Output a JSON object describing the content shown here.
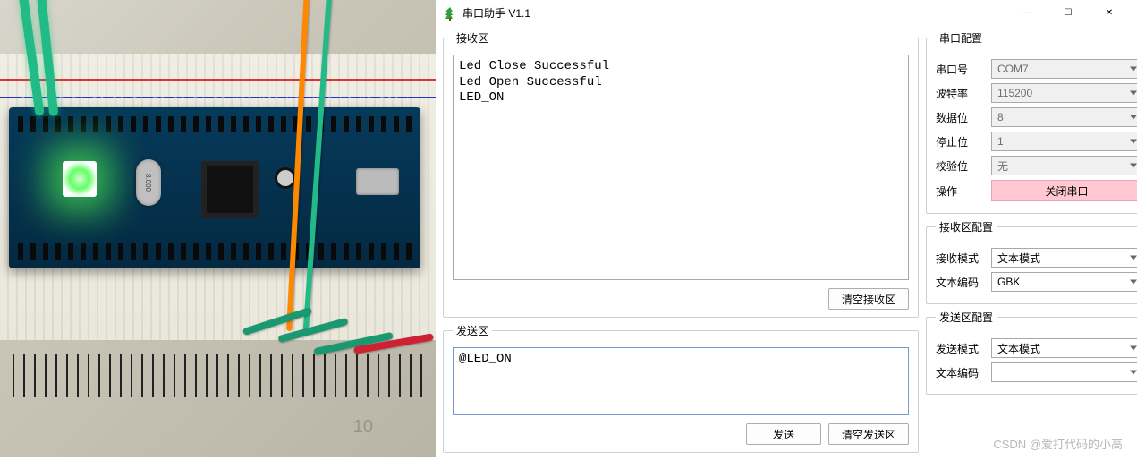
{
  "window": {
    "title": "串口助手 V1.1"
  },
  "receive": {
    "legend": "接收区",
    "content": "Led Close Successful\nLed Open Successful\nLED_ON",
    "clear_btn": "清空接收区"
  },
  "send": {
    "legend": "发送区",
    "content": "@LED_ON",
    "send_btn": "发送",
    "clear_btn": "清空发送区"
  },
  "port_cfg": {
    "legend": "串口配置",
    "port_label": "串口号",
    "port_value": "COM7",
    "baud_label": "波特率",
    "baud_value": "115200",
    "data_label": "数据位",
    "data_value": "8",
    "stop_label": "停止位",
    "stop_value": "1",
    "parity_label": "校验位",
    "parity_value": "无",
    "action_label": "操作",
    "action_btn": "关闭串口"
  },
  "recv_cfg": {
    "legend": "接收区配置",
    "mode_label": "接收模式",
    "mode_value": "文本模式",
    "enc_label": "文本编码",
    "enc_value": "GBK"
  },
  "send_cfg": {
    "legend": "发送区配置",
    "mode_label": "发送模式",
    "mode_value": "文本模式",
    "enc_label": "文本编码"
  },
  "watermark": "CSDN @爱打代码的小高",
  "photo": {
    "mark": "10"
  }
}
